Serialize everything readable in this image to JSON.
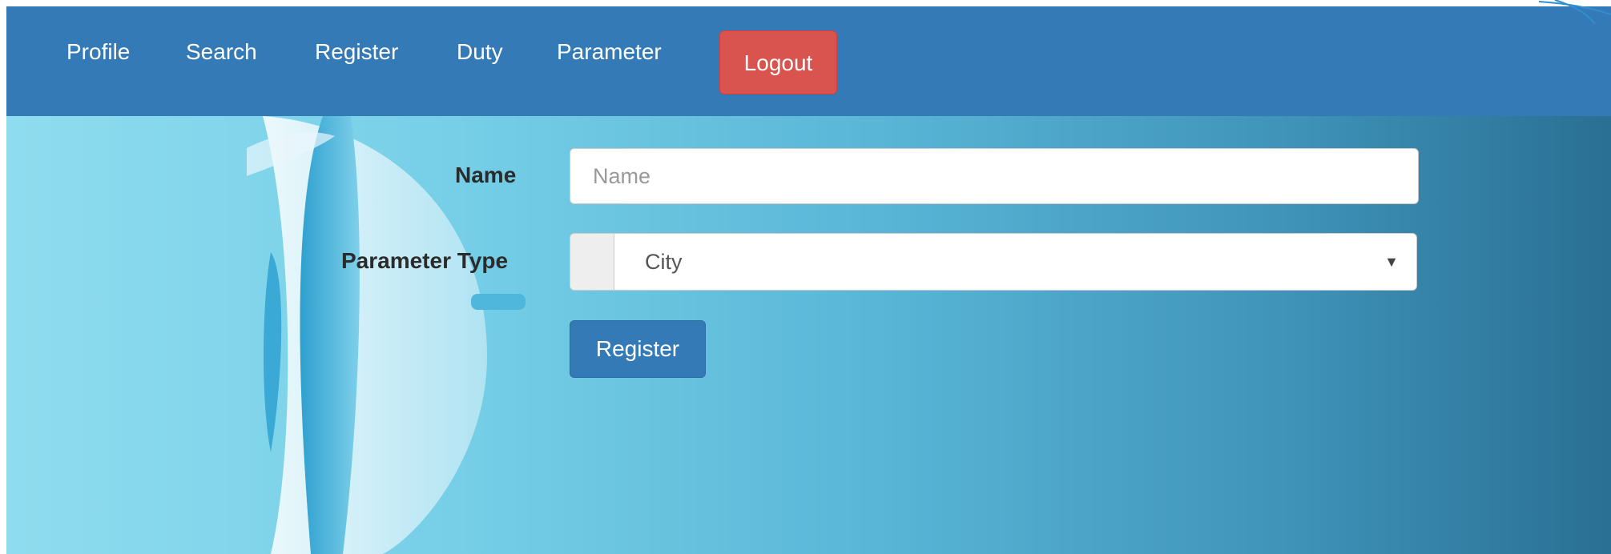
{
  "nav": {
    "items": [
      {
        "label": "Profile"
      },
      {
        "label": "Search"
      },
      {
        "label": "Register"
      },
      {
        "label": "Duty"
      },
      {
        "label": "Parameter"
      }
    ],
    "logout_label": "Logout"
  },
  "form": {
    "name": {
      "label": "Name",
      "placeholder": "Name",
      "value": ""
    },
    "parameter_type": {
      "label": "Parameter Type",
      "selected": "City"
    },
    "submit_label": "Register"
  },
  "icons": {
    "select_caret": "caret-down-icon"
  },
  "colors": {
    "navbar": "#337ab7",
    "logout": "#d9534f",
    "primary_button": "#337ab7"
  }
}
